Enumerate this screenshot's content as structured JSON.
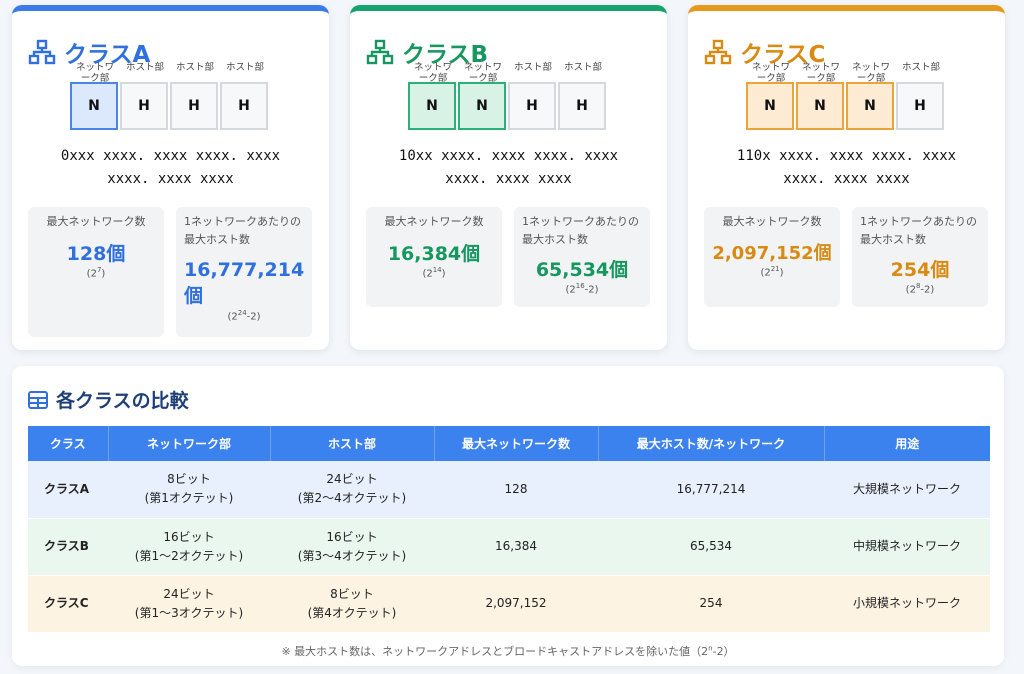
{
  "cards": [
    {
      "title": "クラスA",
      "labels": [
        "ネットワ\nーク部",
        "ホスト部",
        "ホスト部",
        "ホスト部"
      ],
      "blocks": [
        "N",
        "H",
        "H",
        "H"
      ],
      "binary_line1": "0xxx xxxx. xxxx xxxx. xxxx",
      "binary_line2": "xxxx. xxxx xxxx",
      "max_networks_label": "最大ネットワーク数",
      "max_networks_value": "128個",
      "max_networks_note_base": "2",
      "max_networks_note_exp": "7",
      "max_hosts_label": "1ネットワークあたりの最大ホスト数",
      "max_hosts_value_line1": "16,777,214",
      "max_hosts_value_line2": "個",
      "max_hosts_note_base": "2",
      "max_hosts_note_exp": "24",
      "max_hosts_note_tail": "-2"
    },
    {
      "title": "クラスB",
      "labels": [
        "ネットワ\nーク部",
        "ネットワ\nーク部",
        "ホスト部",
        "ホスト部"
      ],
      "blocks": [
        "N",
        "N",
        "H",
        "H"
      ],
      "binary_line1": "10xx xxxx. xxxx xxxx. xxxx",
      "binary_line2": "xxxx. xxxx xxxx",
      "max_networks_label": "最大ネットワーク数",
      "max_networks_value": "16,384個",
      "max_networks_note_base": "2",
      "max_networks_note_exp": "14",
      "max_hosts_label": "1ネットワークあたりの最大ホスト数",
      "max_hosts_value_line1": "65,534個",
      "max_hosts_note_base": "2",
      "max_hosts_note_exp": "16",
      "max_hosts_note_tail": "-2"
    },
    {
      "title": "クラスC",
      "labels": [
        "ネットワ\nーク部",
        "ネットワ\nーク部",
        "ネットワ\nーク部",
        "ホスト部"
      ],
      "blocks": [
        "N",
        "N",
        "N",
        "H"
      ],
      "binary_line1": "110x xxxx. xxxx xxxx. xxxx",
      "binary_line2": "xxxx. xxxx xxxx",
      "max_networks_label": "最大ネットワーク数",
      "max_networks_value": "2,097,152個",
      "max_networks_note_base": "2",
      "max_networks_note_exp": "21",
      "max_hosts_label": "1ネットワークあたりの最大ホスト数",
      "max_hosts_value_line1": "254個",
      "max_hosts_note_base": "2",
      "max_hosts_note_exp": "8",
      "max_hosts_note_tail": "-2"
    }
  ],
  "comparison": {
    "title": "各クラスの比較",
    "headers": [
      "クラス",
      "ネットワーク部",
      "ホスト部",
      "最大ネットワーク数",
      "最大ホスト数/ネットワーク",
      "用途"
    ],
    "rows": [
      {
        "cls": "クラスA",
        "net1": "8ビット",
        "net2": "(第1オクテット)",
        "host1": "24ビット",
        "host2": "(第2〜4オクテット)",
        "max_net": "128",
        "max_host": "16,777,214",
        "use": "大規模ネットワーク"
      },
      {
        "cls": "クラスB",
        "net1": "16ビット",
        "net2": "(第1〜2オクテット)",
        "host1": "16ビット",
        "host2": "(第3〜4オクテット)",
        "max_net": "16,384",
        "max_host": "65,534",
        "use": "中規模ネットワーク"
      },
      {
        "cls": "クラスC",
        "net1": "24ビット",
        "net2": "(第1〜3オクテット)",
        "host1": "8ビット",
        "host2": "(第4オクテット)",
        "max_net": "2,097,152",
        "max_host": "254",
        "use": "小規模ネットワーク"
      }
    ],
    "footnote_pre": "※ 最大ホスト数は、ネットワークアドレスとブロードキャストアドレスを除いた値（2",
    "footnote_exp": "n",
    "footnote_post": "-2）"
  },
  "colors": {
    "class_a": "#3b7be8",
    "class_b": "#16a36c",
    "class_c": "#e69a1c",
    "table_header": "#3c82ee"
  },
  "icons": {
    "card_icon": "network-icon",
    "table_icon": "table-icon"
  }
}
